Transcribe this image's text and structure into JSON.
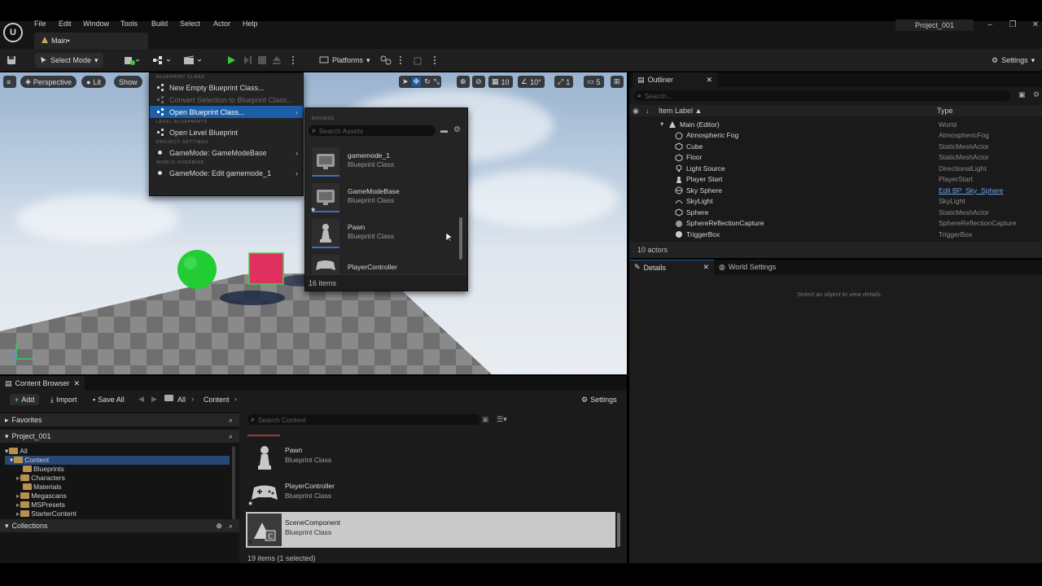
{
  "app": {
    "logo_glyph": "U",
    "menu": [
      "File",
      "Edit",
      "Window",
      "Tools",
      "Build",
      "Select",
      "Actor",
      "Help"
    ],
    "main_tab": "Main•",
    "project": "Project_001"
  },
  "toolbar": {
    "select_mode": "Select Mode",
    "platforms": "Platforms",
    "settings": "Settings"
  },
  "viewport": {
    "perspective": "Perspective",
    "lit": "Lit",
    "show": "Show",
    "grid_snap": "10",
    "rot_snap": "10°",
    "scale_snap": "1",
    "cam_speed": "5"
  },
  "blueprint_menu": {
    "section_blueprint_class": "BLUEPRINT CLASS",
    "new_empty": "New Empty Blueprint Class...",
    "convert_selection": "Convert Selection to Blueprint Class...",
    "open_blueprint_class": "Open Blueprint Class...",
    "section_level_blueprints": "LEVEL BLUEPRINTS",
    "open_level_blueprint": "Open Level Blueprint",
    "section_project_settings": "PROJECT SETTINGS",
    "gamemode_base": "GameMode: GameModeBase",
    "section_world_override": "WORLD OVERRIDE",
    "gamemode_edit": "GameMode: Edit gamemode_1"
  },
  "browse_popup": {
    "section": "BROWSE",
    "search_placeholder": "Search Assets",
    "items": [
      {
        "name": "gamemode_1",
        "type": "Blueprint Class"
      },
      {
        "name": "GameModeBase",
        "type": "Blueprint Class"
      },
      {
        "name": "Pawn",
        "type": "Blueprint Class"
      },
      {
        "name": "PlayerController",
        "type": ""
      }
    ],
    "count": "16 items"
  },
  "outliner": {
    "tab": "Outliner",
    "search_placeholder": "Search...",
    "col_label": "Item Label ▲",
    "col_type": "Type",
    "rows": [
      {
        "name": "Main (Editor)",
        "type": "World"
      },
      {
        "name": "Atmospheric Fog",
        "type": "AtmosphericFog"
      },
      {
        "name": "Cube",
        "type": "StaticMeshActor"
      },
      {
        "name": "Floor",
        "type": "StaticMeshActor"
      },
      {
        "name": "Light Source",
        "type": "DirectionalLight"
      },
      {
        "name": "Player Start",
        "type": "PlayerStart"
      },
      {
        "name": "Sky Sphere",
        "type": "Edit BP_Sky_Sphere"
      },
      {
        "name": "SkyLight",
        "type": "SkyLight"
      },
      {
        "name": "Sphere",
        "type": "StaticMeshActor"
      },
      {
        "name": "SphereReflectionCapture",
        "type": "SphereReflectionCapture"
      },
      {
        "name": "TriggerBox",
        "type": "TriggerBox"
      }
    ],
    "count": "10 actors"
  },
  "details": {
    "tab_details": "Details",
    "tab_world": "World Settings",
    "empty_msg": "Select an object to view details."
  },
  "content_browser": {
    "tab": "Content Browser",
    "add": "Add",
    "import": "Import",
    "save_all": "Save All",
    "crumb_all": "All",
    "crumb_content": "Content",
    "settings": "Settings",
    "favorites": "Favorites",
    "project": "Project_001",
    "search_placeholder": "Search Content",
    "tree": [
      "All",
      "Content",
      "Blueprints",
      "Characters",
      "Materials",
      "Megascans",
      "MSPresets",
      "StarterContent"
    ],
    "collections": "Collections",
    "assets": [
      {
        "name": "Pawn",
        "type": "Blueprint Class"
      },
      {
        "name": "PlayerController",
        "type": "Blueprint Class"
      },
      {
        "name": "SceneComponent",
        "type": "Blueprint Class"
      }
    ],
    "status": "19 items (1 selected)"
  },
  "colors": {
    "accent_blue": "#1c5ea8",
    "play_green": "#3ec43e",
    "sphere_green": "#22cc33",
    "cube_pink": "#e03060"
  }
}
